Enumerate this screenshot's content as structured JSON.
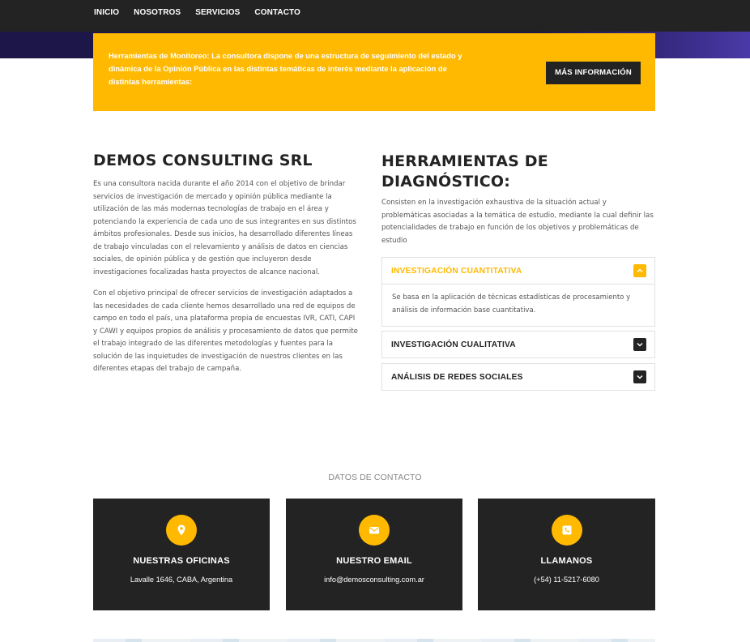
{
  "nav": {
    "items": [
      "INICIO",
      "NOSOTROS",
      "SERVICIOS",
      "CONTACTO"
    ]
  },
  "banner": {
    "text": "Herramientas de Monitoreo: La consultora dispone de una estructura de seguimiento del estado y dinámica de la Opinión Pública en las distintas temáticas de interés mediante la aplicación de distintas herramientas:",
    "button_label": "MÁS INFORMACIÓN"
  },
  "about": {
    "title": "DEMOS CONSULTING SRL",
    "paragraph1": "Es una consultora nacida durante el año 2014 con el objetivo de brindar servicios de investigación de mercado y opinión pública mediante la utilización de las más modernas tecnologías de trabajo en el área y potenciando la experiencia de cada uno de sus integrantes en sus distintos ámbitos profesionales. Desde sus inicios, ha desarrollado diferentes líneas de trabajo vinculadas con el relevamiento y análisis de datos en ciencias sociales, de opinión pública y de gestión que incluyeron desde investigaciones focalizadas hasta proyectos de alcance nacional.",
    "paragraph2": "Con el objetivo principal de ofrecer servicios de investigación adaptados a las necesidades de cada cliente hemos desarrollado una red de equipos de campo en todo el país, una plataforma propia de encuestas IVR, CATI, CAPI y CAWI y equipos propios de análisis y procesamiento de datos que permite el trabajo integrado de las diferentes metodologías y fuentes para la solución de las inquietudes de investigación de nuestros clientes en las diferentes etapas del trabajo de campaña."
  },
  "tools": {
    "title": "HERRAMIENTAS DE DIAGNÓSTICO:",
    "intro": "Consisten en la investigación exhaustiva de la situación actual y problemáticas asociadas a la temática de estudio, mediante la cual definir las potencialidades de trabajo en función de los objetivos y problemáticas de estudio",
    "accordion": [
      {
        "label": "INVESTIGACIÓN CUANTITATIVA",
        "open": true,
        "content": "Se basa en la aplicación de técnicas estadísticas de procesamiento y análisis de información base cuantitativa."
      },
      {
        "label": "INVESTIGACIÓN CUALITATIVA",
        "open": false
      },
      {
        "label": "ANÁLISIS DE REDES SOCIALES",
        "open": false
      }
    ]
  },
  "contact": {
    "heading": "DATOS DE CONTACTO",
    "cards": [
      {
        "icon": "map-pin-icon",
        "title": "NUESTRAS OFICINAS",
        "value": "Lavalle 1646, CABA, Argentina"
      },
      {
        "icon": "envelope-icon",
        "title": "NUESTRO EMAIL",
        "value": "info@demosconsulting.com.ar"
      },
      {
        "icon": "phone-icon",
        "title": "LLAMANOS",
        "value": "(+54) 11-5217-6080"
      }
    ]
  },
  "colors": {
    "accent": "#ffb900",
    "dark": "#232323",
    "hero": "#1c1748"
  }
}
